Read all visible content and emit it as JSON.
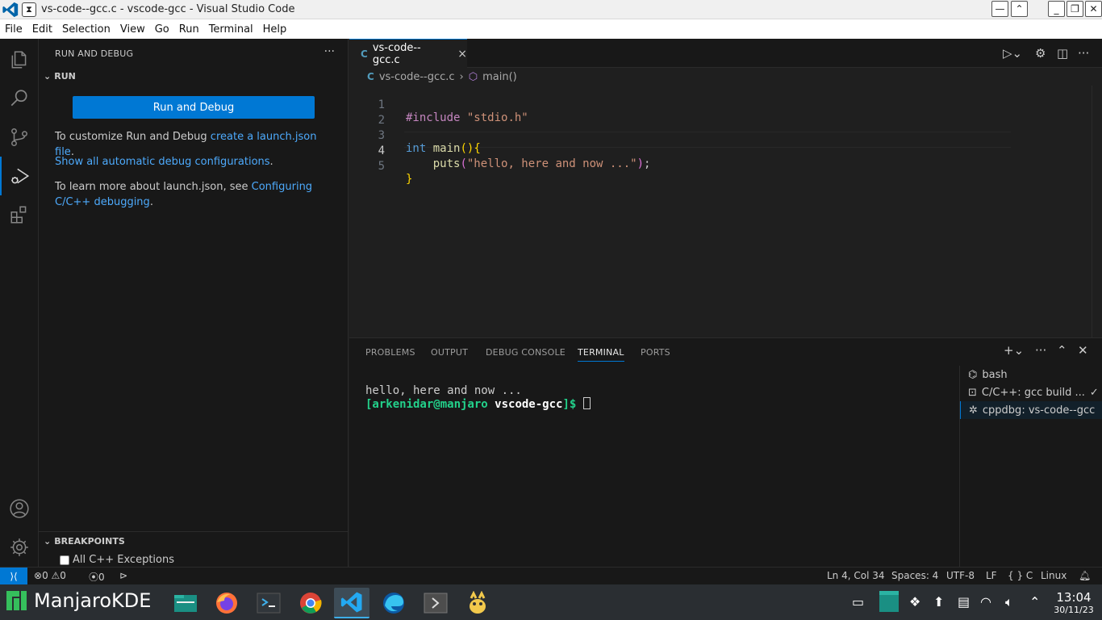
{
  "window": {
    "title": "vs-code--gcc.c - vscode-gcc - Visual Studio Code",
    "pin_glyph": "⧗"
  },
  "menu": [
    "File",
    "Edit",
    "Selection",
    "View",
    "Go",
    "Run",
    "Terminal",
    "Help"
  ],
  "sidebar": {
    "header": "RUN AND DEBUG",
    "more": "···",
    "run_section": "RUN",
    "run_button": "Run and Debug",
    "customize_prefix": "To customize Run and Debug ",
    "customize_link": "create a launch.json file",
    "customize_suffix": ".",
    "show_all_link": "Show all automatic debug configurations",
    "show_all_suffix": ".",
    "learn_prefix": "To learn more about launch.json, see ",
    "learn_link": "Configuring C/C++ debugging",
    "learn_suffix": ".",
    "breakpoints_section": "BREAKPOINTS",
    "bp_all_cpp": "All C++ Exceptions"
  },
  "editor": {
    "tab_icon": "C",
    "tab_label": "vs-code--gcc.c",
    "tab_close": "×",
    "breadcrumb_file": "vs-code--gcc.c",
    "breadcrumb_sep": "›",
    "breadcrumb_symbol": "main()",
    "line_numbers": [
      "1",
      "2",
      "3",
      "4",
      "5"
    ],
    "code": {
      "l1_pp": "#include",
      "l1_str": "\"stdio.h\"",
      "l3_kw": "int",
      "l3_fn": "main",
      "l3_paren": "()",
      "l3_brace": "{",
      "l4_fn": "puts",
      "l4_open": "(",
      "l4_str": "\"hello, here and now ...\"",
      "l4_close": ")",
      "l4_semi": ";",
      "l5_brace": "}"
    }
  },
  "panel": {
    "tabs": [
      "PROBLEMS",
      "OUTPUT",
      "DEBUG CONSOLE",
      "TERMINAL",
      "PORTS"
    ],
    "active_tab": "TERMINAL",
    "terminal_output": "hello, here and now ...",
    "prompt_user": "[arkenidar@manjaro ",
    "prompt_dir": "vscode-gcc",
    "prompt_end": "]$ ",
    "terminals": [
      {
        "label": "bash",
        "icon": "terminal-bash-icon"
      },
      {
        "label": "C/C++: gcc build ...",
        "icon": "terminal-task-icon",
        "status": "✓"
      },
      {
        "label": "cppdbg: vs-code--gcc",
        "icon": "debug-icon",
        "selected": true
      }
    ]
  },
  "status": {
    "errors": "0",
    "warnings": "0",
    "ports": "0",
    "position": "Ln 4, Col 34",
    "spaces": "Spaces: 4",
    "encoding": "UTF-8",
    "eol": "LF",
    "language": "C",
    "language_braces": "{ }",
    "platform": "Linux"
  },
  "taskbar": {
    "start_label": "ManjaroKDE",
    "time": "13:04",
    "date": "30/11/23"
  },
  "colors": {
    "accent": "#0078d4",
    "link": "#4daafc",
    "terminal_green": "#23d18b",
    "manjaro_green": "#35bf5c"
  }
}
